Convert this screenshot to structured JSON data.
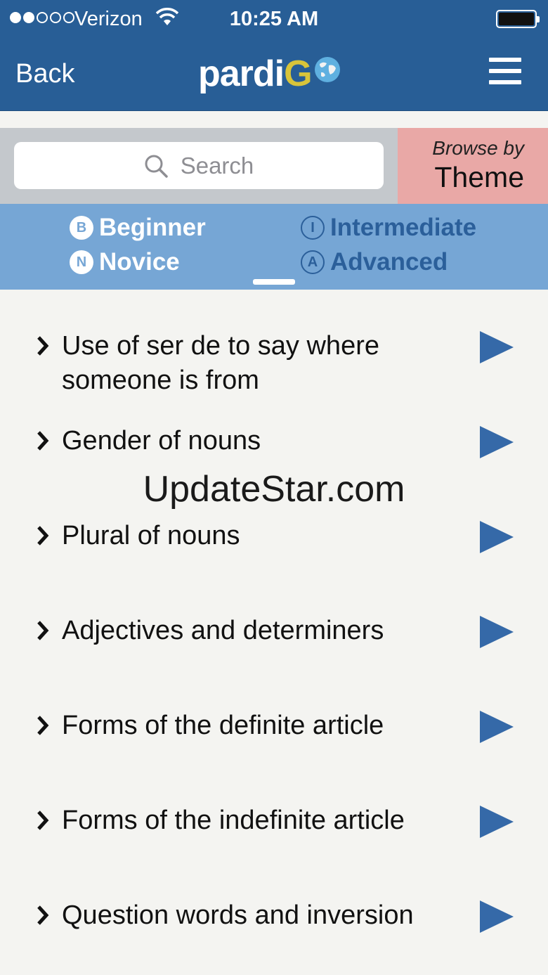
{
  "status_bar": {
    "carrier": "Verizon",
    "time": "10:25 AM"
  },
  "header": {
    "back_label": "Back",
    "logo_text": "pardi",
    "logo_g": "G"
  },
  "search": {
    "placeholder": "Search"
  },
  "browse": {
    "line1": "Browse by",
    "line2": "Theme"
  },
  "levels": [
    {
      "badge": "B",
      "label": "Beginner",
      "active": true
    },
    {
      "badge": "N",
      "label": "Novice",
      "active": true
    },
    {
      "badge": "I",
      "label": "Intermediate",
      "active": false
    },
    {
      "badge": "A",
      "label": "Advanced",
      "active": false
    }
  ],
  "topics": [
    "Use of ser de to say where someone is from",
    "Gender of nouns",
    "Plural of nouns",
    "Adjectives and determiners",
    "Forms of the definite article",
    "Forms of the indefinite article",
    "Question words and inversion"
  ],
  "watermark": "UpdateStar.com",
  "colors": {
    "header": "#285e96",
    "levels_bar": "#76a6d5",
    "browse": "#e9a8a6",
    "play": "#3569a8"
  }
}
